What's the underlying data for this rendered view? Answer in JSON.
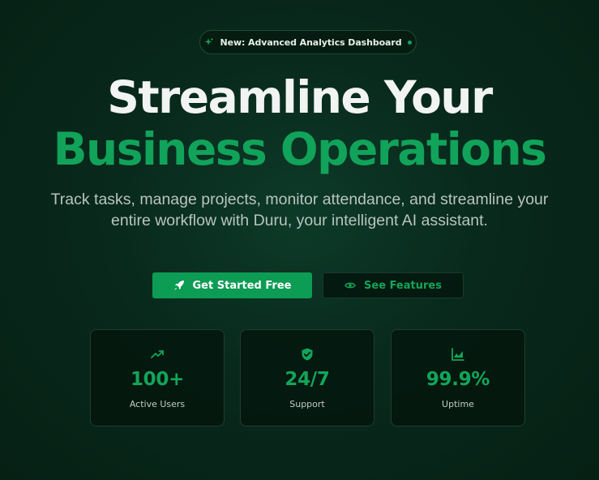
{
  "badge": {
    "text": "New: Advanced Analytics Dashboard",
    "icon": "sparkles-icon"
  },
  "hero": {
    "title_line1": "Streamline Your",
    "title_line2": "Business Operations",
    "subtitle": "Track tasks, manage projects, monitor attendance, and streamline your entire workflow with Duru, your intelligent AI assistant."
  },
  "buttons": {
    "primary": {
      "label": "Get Started Free",
      "icon": "rocket-icon"
    },
    "secondary": {
      "label": "See Features",
      "icon": "eye-icon"
    }
  },
  "stats": [
    {
      "icon": "trending-up-icon",
      "value": "100+",
      "label": "Active Users"
    },
    {
      "icon": "shield-check-icon",
      "value": "24/7",
      "label": "Support"
    },
    {
      "icon": "area-chart-icon",
      "value": "99.9%",
      "label": "Uptime"
    }
  ],
  "colors": {
    "accent": "#12a55a",
    "primary_button": "#0c9c54",
    "background": "#062014"
  }
}
